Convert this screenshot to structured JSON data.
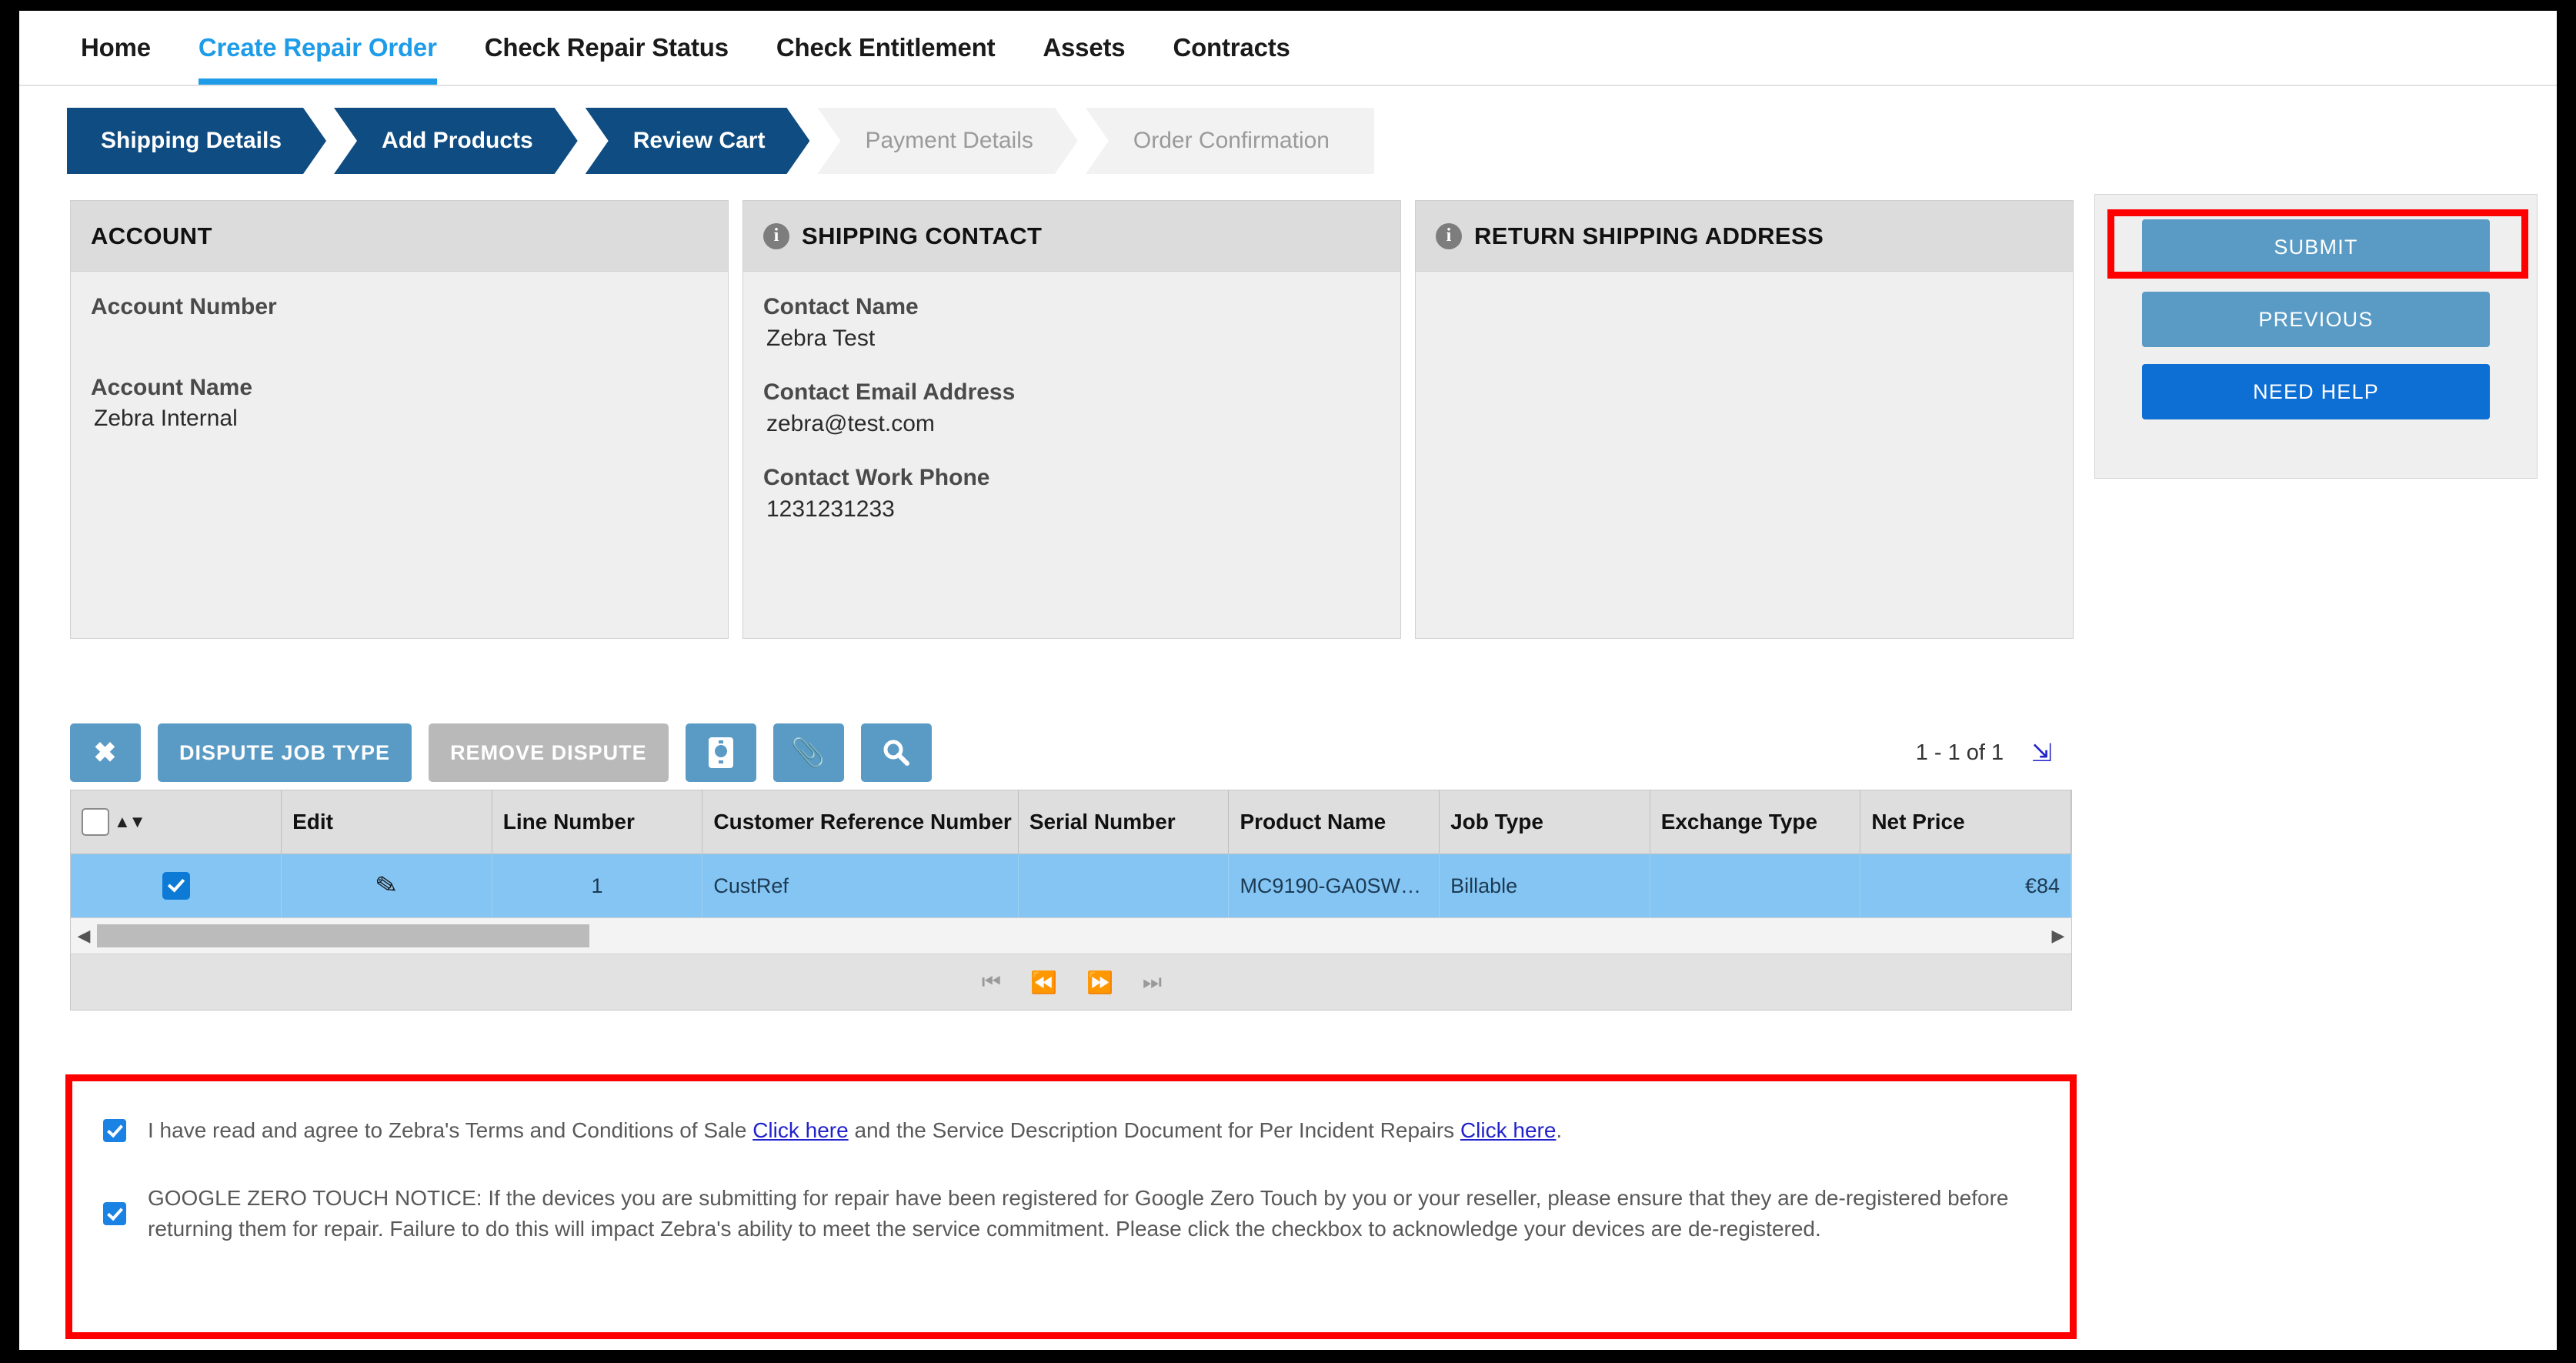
{
  "nav": {
    "tabs": [
      {
        "label": "Home",
        "active": false
      },
      {
        "label": "Create Repair Order",
        "active": true
      },
      {
        "label": "Check Repair Status",
        "active": false
      },
      {
        "label": "Check Entitlement",
        "active": false
      },
      {
        "label": "Assets",
        "active": false
      },
      {
        "label": "Contracts",
        "active": false
      }
    ]
  },
  "wizard": {
    "steps": [
      {
        "label": "Shipping Details",
        "state": "done"
      },
      {
        "label": "Add Products",
        "state": "done"
      },
      {
        "label": "Review Cart",
        "state": "current"
      },
      {
        "label": "Payment Details",
        "state": "pending"
      },
      {
        "label": "Order Confirmation",
        "state": "pending"
      }
    ]
  },
  "cards": {
    "account": {
      "title": "ACCOUNT",
      "has_info_icon": false,
      "fields": [
        {
          "label": "Account Number",
          "value": ""
        },
        {
          "label": "Account Name",
          "value": "Zebra Internal"
        }
      ]
    },
    "shipping_contact": {
      "title": "SHIPPING CONTACT",
      "has_info_icon": true,
      "info_icon": "info-icon",
      "fields": [
        {
          "label": "Contact Name",
          "value": "Zebra Test"
        },
        {
          "label": "Contact Email Address",
          "value": "zebra@test.com"
        },
        {
          "label": "Contact Work Phone",
          "value": "1231231233"
        }
      ]
    },
    "return_shipping_address": {
      "title": "RETURN SHIPPING ADDRESS",
      "has_info_icon": true,
      "info_icon": "info-icon",
      "fields": []
    }
  },
  "action_panel": {
    "submit_label": "SUBMIT",
    "previous_label": "PREVIOUS",
    "need_help_label": "NEED HELP",
    "submit_highlighted": true,
    "highlight_color": "#ff0000",
    "light_button_color": "#5a9bc6",
    "bold_button_color": "#0d6fd4"
  },
  "toolbar": {
    "cancel_icon": "close-x-icon",
    "dispute_job_type_label": "DISPUTE JOB TYPE",
    "remove_dispute_label": "REMOVE DISPUTE",
    "remove_dispute_disabled": true,
    "device_icon": "device-settings-icon",
    "attachment_icon": "paperclip-icon",
    "search_icon": "magnifier-icon"
  },
  "pager": {
    "count_text": "1 - 1 of 1",
    "expand_icon": "expand-diagonal-icon",
    "first_icon": "first-page-icon",
    "prev_icon": "previous-page-icon",
    "next_icon": "next-page-icon",
    "last_icon": "last-page-icon"
  },
  "grid": {
    "columns": [
      "",
      "Edit",
      "Line Number",
      "Customer Reference Number",
      "Serial Number",
      "Product Name",
      "Job Type",
      "Exchange Type",
      "Net Price"
    ],
    "rows": [
      {
        "selected": true,
        "edit_icon": "pencil-icon",
        "line_number": "1",
        "customer_reference_number": "CustRef",
        "serial_number": "",
        "product_name": "MC9190-GA0SW…",
        "job_type": "Billable",
        "exchange_type": "",
        "net_price": "€84"
      }
    ]
  },
  "terms": {
    "highlighted": true,
    "highlight_color": "#ff0000",
    "items": [
      {
        "checked": true,
        "text_before": "I have read and agree to Zebra's Terms and Conditions of Sale ",
        "link1": "Click here",
        "text_middle": " and the Service Description Document for Per Incident Repairs ",
        "link2": "Click here",
        "text_after": "."
      },
      {
        "checked": true,
        "text": "GOOGLE ZERO TOUCH NOTICE: If the devices you are submitting for repair have been registered for Google Zero Touch by you or your reseller, please ensure that they are de-registered before returning them for repair. Failure to do this will impact Zebra's ability to meet the service commitment. Please click the checkbox to acknowledge your devices are de-registered."
      }
    ]
  }
}
